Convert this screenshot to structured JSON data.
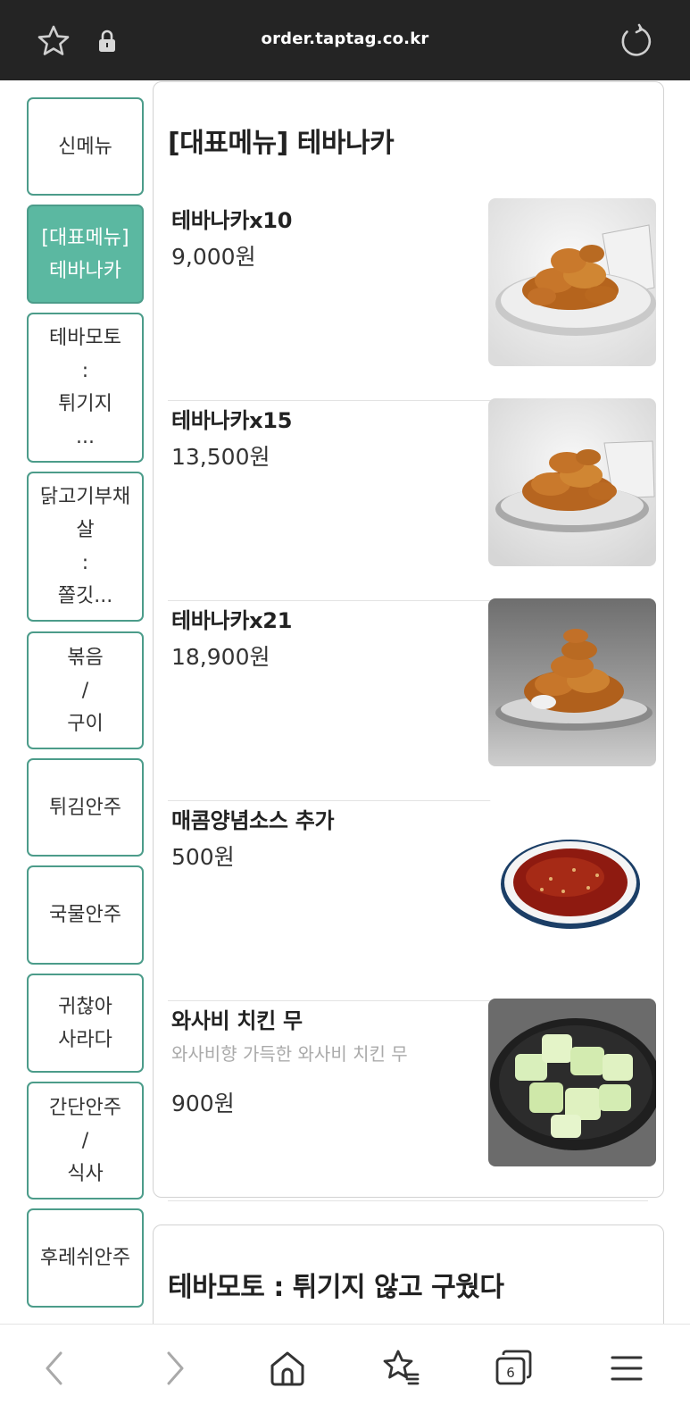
{
  "browser": {
    "url": "order.taptag.co.kr",
    "tab_count": "6"
  },
  "sidebar": {
    "items": [
      {
        "label": "신메뉴",
        "active": false
      },
      {
        "label": "[대표메뉴]\n테바나카",
        "active": true
      },
      {
        "label": "테바모토\n:\n튀기지\n...",
        "active": false
      },
      {
        "label": "닭고기부채\n살\n:\n쫄깃...",
        "active": false
      },
      {
        "label": "볶음\n/\n구이",
        "active": false
      },
      {
        "label": "튀김안주",
        "active": false
      },
      {
        "label": "국물안주",
        "active": false
      },
      {
        "label": "귀찮아\n사라다",
        "active": false
      },
      {
        "label": "간단안주\n/\n식사",
        "active": false
      },
      {
        "label": "후레쉬안주",
        "active": false
      }
    ]
  },
  "sections": [
    {
      "title": "[대표메뉴] 테바나카",
      "items": [
        {
          "name": "테바나카x10",
          "price": "9,000원",
          "photo": "fried-wings-plate"
        },
        {
          "name": "테바나카x15",
          "price": "13,500원",
          "photo": "fried-wings-plate"
        },
        {
          "name": "테바나카x21",
          "price": "18,900원",
          "photo": "fried-wings-pile"
        },
        {
          "name": "매콤양념소스 추가",
          "price": "500원",
          "photo": "chili-sauce-dish"
        },
        {
          "name": "와사비 치킨 무",
          "description": "와사비향 가득한 와사비 치킨 무",
          "price": "900원",
          "photo": "pickled-radish-bowl"
        }
      ]
    },
    {
      "title": "테바모토 : 튀기지 않고 구웠다"
    }
  ],
  "colors": {
    "accent": "#5bb8a1",
    "accent_border": "#4c9c8a",
    "top_bar": "#242424"
  }
}
